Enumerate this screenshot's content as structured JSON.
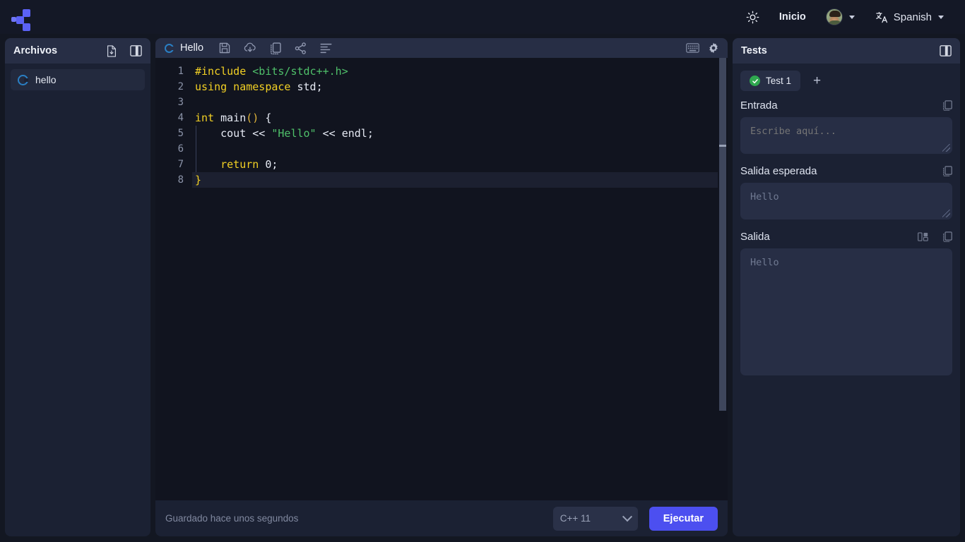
{
  "header": {
    "logo_name": "app-logo",
    "theme_toggle_label": "",
    "home_label": "Inicio",
    "language_label": "Spanish",
    "accent_color": "#4c4ff0"
  },
  "files_panel": {
    "title": "Archivos",
    "new_file_icon": "new-file-icon",
    "toggle_icon": "panel-toggle-icon",
    "items": [
      {
        "name": "hello",
        "icon": "cpp-file-icon"
      }
    ]
  },
  "editor": {
    "tab_title": "Hello",
    "tab_icon": "cpp-file-icon",
    "toolbar_icons": [
      "save-icon",
      "cloud-download-icon",
      "duplicate-icon",
      "share-icon",
      "format-code-icon"
    ],
    "right_icons": [
      "keyboard-shortcuts-icon",
      "settings-gear-icon"
    ],
    "lines": [
      {
        "n": "1",
        "tokens": [
          {
            "t": "#include ",
            "c": "kw"
          },
          {
            "t": "<bits/stdc++.h>",
            "c": "str"
          }
        ]
      },
      {
        "n": "2",
        "tokens": [
          {
            "t": "using namespace ",
            "c": "kw"
          },
          {
            "t": "std;",
            "c": "pl"
          }
        ]
      },
      {
        "n": "3",
        "tokens": []
      },
      {
        "n": "4",
        "tokens": [
          {
            "t": "int ",
            "c": "kw"
          },
          {
            "t": "main",
            "c": "pl"
          },
          {
            "t": "()",
            "c": "pnc"
          },
          {
            "t": " {",
            "c": "pl"
          }
        ]
      },
      {
        "n": "5",
        "tokens": [
          {
            "t": "    cout << ",
            "c": "pl"
          },
          {
            "t": "\"Hello\"",
            "c": "str"
          },
          {
            "t": " << endl;",
            "c": "pl"
          }
        ]
      },
      {
        "n": "6",
        "tokens": []
      },
      {
        "n": "7",
        "tokens": [
          {
            "t": "    ",
            "c": "pl"
          },
          {
            "t": "return ",
            "c": "kw"
          },
          {
            "t": "0;",
            "c": "pl"
          }
        ]
      },
      {
        "n": "8",
        "tokens": [
          {
            "t": "}",
            "c": "br"
          }
        ],
        "active": true
      }
    ],
    "footer": {
      "saved_text": "Guardado hace unos segundos",
      "language": "C++ 11",
      "run_label": "Ejecutar"
    }
  },
  "tests_panel": {
    "title": "Tests",
    "toggle_icon": "panel-toggle-icon",
    "tabs": [
      {
        "label": "Test 1",
        "status": "passed"
      }
    ],
    "add_label": "+",
    "input": {
      "label": "Entrada",
      "value": "",
      "placeholder": "Escribe aquí...",
      "copy_icon": "copy-icon"
    },
    "expected": {
      "label": "Salida esperada",
      "value": "Hello",
      "placeholder": "Hello",
      "copy_icon": "copy-icon"
    },
    "output": {
      "label": "Salida",
      "value": "Hello",
      "diff_icon": "compare-diff-icon",
      "copy_icon": "copy-icon"
    }
  }
}
